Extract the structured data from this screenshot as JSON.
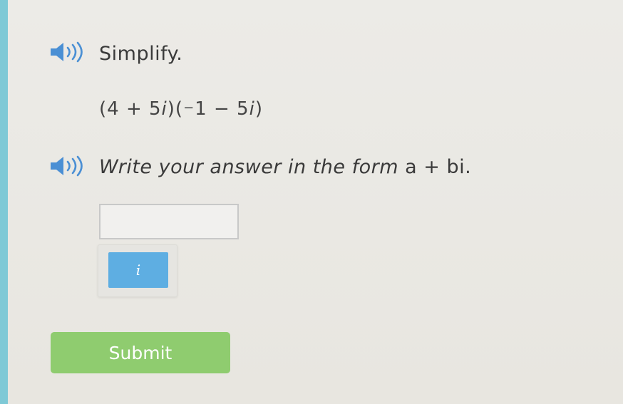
{
  "question": {
    "instruction": "Simplify.",
    "expression": {
      "open1": "(4 + 5",
      "var1": "i",
      "mid": ")(",
      "minus_sign": "−",
      "part2": "1 − 5",
      "var2": "i",
      "close": ")"
    },
    "answer_prompt_text": "Write your answer in the form ",
    "answer_form": "a + bi",
    "answer_period": "."
  },
  "answer_input": {
    "value": "",
    "placeholder": ""
  },
  "keypad": {
    "i_key_label": "i"
  },
  "submit": {
    "label": "Submit"
  },
  "icons": {
    "audio": "speaker-icon"
  },
  "colors": {
    "accent_left_bar": "#7fc9d6",
    "speaker_blue": "#4a8fd4",
    "key_blue": "#5eaee2",
    "submit_green": "#8fcc6f"
  }
}
